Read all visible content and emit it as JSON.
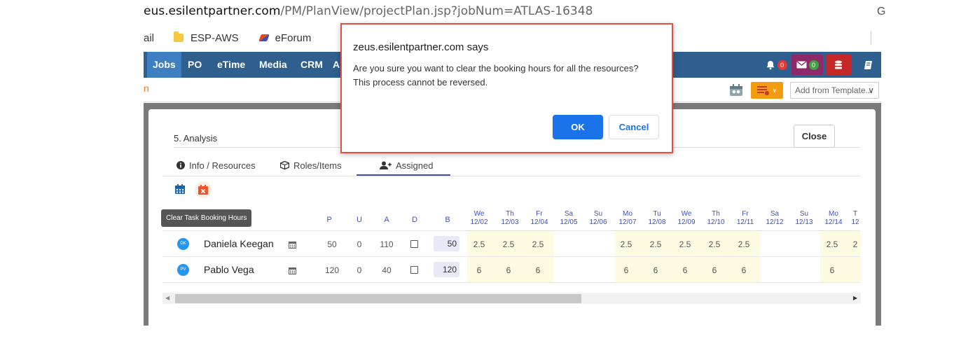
{
  "browser": {
    "url_host": "eus.esilentpartner.com",
    "url_path": "/PM/PlanView/projectPlan.jsp?jobNum=ATLAS-16348",
    "url_right_glyph": "G",
    "bookmarks": [
      {
        "label": "ail"
      },
      {
        "label": "ESP-AWS"
      },
      {
        "label": "eForum"
      }
    ]
  },
  "nav": {
    "items": [
      "Jobs",
      "PO",
      "eTime",
      "Media",
      "CRM",
      "A"
    ],
    "notif_count": "0",
    "mail_count": "0"
  },
  "toolbar": {
    "left_text": "n",
    "template_placeholder": "Add from Template...",
    "template_chevron": "∨"
  },
  "panel": {
    "task_title": "5. Analysis",
    "close_label": "Close",
    "tabs": [
      {
        "label": "Info / Resources"
      },
      {
        "label": "Roles/Items"
      },
      {
        "label": "Assigned"
      }
    ],
    "tooltip": "Clear Task Booking Hours",
    "columns": [
      "P",
      "U",
      "A",
      "D",
      "B"
    ],
    "days": [
      {
        "d": "We",
        "date": "12/02"
      },
      {
        "d": "Th",
        "date": "12/03"
      },
      {
        "d": "Fr",
        "date": "12/04"
      },
      {
        "d": "Sa",
        "date": "12/05"
      },
      {
        "d": "Su",
        "date": "12/06"
      },
      {
        "d": "Mo",
        "date": "12/07"
      },
      {
        "d": "Tu",
        "date": "12/08"
      },
      {
        "d": "We",
        "date": "12/09"
      },
      {
        "d": "Th",
        "date": "12/10"
      },
      {
        "d": "Fr",
        "date": "12/11"
      },
      {
        "d": "Sa",
        "date": "12/12"
      },
      {
        "d": "Su",
        "date": "12/13"
      },
      {
        "d": "Mo",
        "date": "12/14"
      },
      {
        "d": "T",
        "date": "12"
      }
    ],
    "rows": [
      {
        "initials": "DK",
        "name": "Daniela Keegan",
        "P": "50",
        "U": "0",
        "A": "110",
        "B": "50",
        "hours": [
          "2.5",
          "2.5",
          "2.5",
          "",
          "",
          "2.5",
          "2.5",
          "2.5",
          "2.5",
          "2.5",
          "",
          "",
          "2.5",
          "2"
        ]
      },
      {
        "initials": "PV",
        "name": "Pablo Vega",
        "P": "120",
        "U": "0",
        "A": "40",
        "B": "120",
        "hours": [
          "6",
          "6",
          "6",
          "",
          "",
          "6",
          "6",
          "6",
          "6",
          "6",
          "",
          "",
          "6",
          ""
        ]
      }
    ]
  },
  "dialog": {
    "title": "zeus.esilentpartner.com says",
    "message_line1": "Are you sure you want to clear the booking hours for all the resources?",
    "message_line2": "This process cannot be reversed.",
    "ok_label": "OK",
    "cancel_label": "Cancel"
  },
  "colors": {
    "nav_bg": "#2f5f8f",
    "accent_blue": "#1a73e8",
    "dialog_highlight": "#e74c3c",
    "weekday_fill": "#fdfbe1"
  }
}
